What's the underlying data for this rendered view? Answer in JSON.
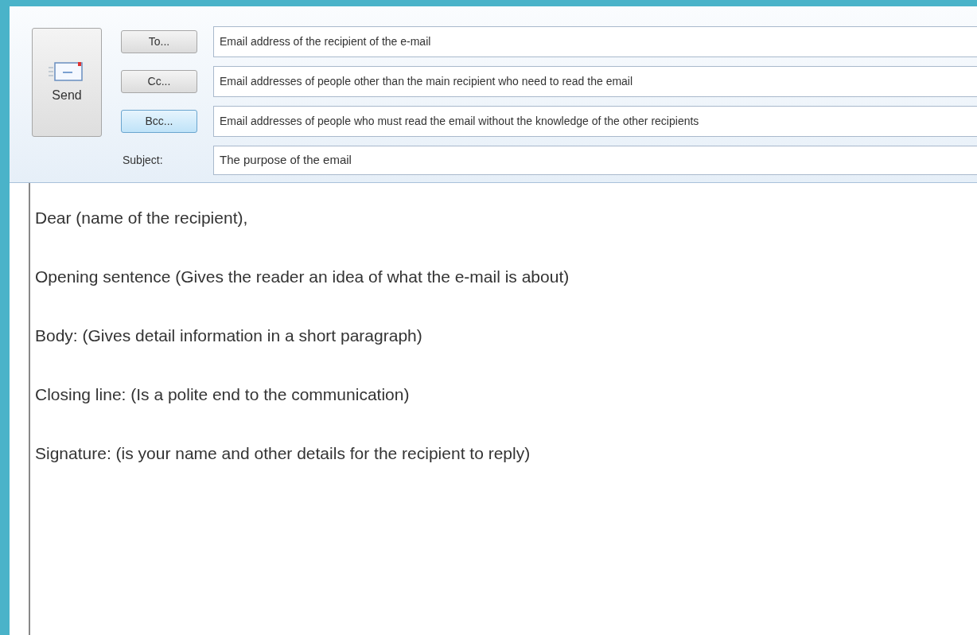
{
  "send_button": {
    "label": "Send"
  },
  "recipients": [
    {
      "label": "To...",
      "selected": false,
      "value": "Email address of the recipient of the e-mail"
    },
    {
      "label": "Cc...",
      "selected": false,
      "value": "Email  addresses of people other than the main recipient who need to read the email"
    },
    {
      "label": "Bcc...",
      "selected": true,
      "value": "Email addresses of people who must read the email without the knowledge of the other recipients"
    }
  ],
  "subject": {
    "label": "Subject:",
    "value": "The purpose of the email"
  },
  "body": [
    "Dear (name of the recipient),",
    "Opening sentence (Gives the reader an idea of what the e-mail is about)",
    "Body: (Gives detail information in a short paragraph)",
    "Closing line: (Is a polite end to the communication)",
    "Signature: (is your name and other details for the recipient to reply)"
  ]
}
